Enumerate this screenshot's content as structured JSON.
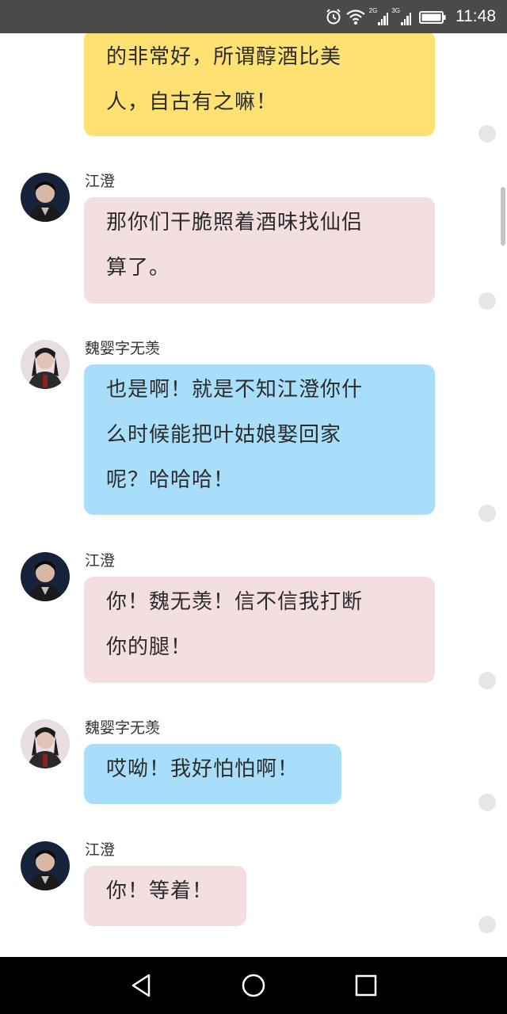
{
  "status_bar": {
    "time": "11:48",
    "network_1": "2G",
    "network_2": "3G",
    "icons": [
      "alarm-icon",
      "wifi-icon",
      "signal-icon",
      "signal-icon",
      "battery-icon"
    ]
  },
  "messages": [
    {
      "sender": "",
      "lines": [
        "的非常好，所谓醇酒比美",
        "人，自古有之嘛！"
      ],
      "color": "#fee173"
    },
    {
      "sender": "江澄",
      "lines": [
        "那你们干脆照着酒味找仙侣",
        "算了。"
      ],
      "color": "#f3dfe0"
    },
    {
      "sender": "魏婴字无羡",
      "lines": [
        "也是啊！就是不知江澄你什",
        "么时候能把叶姑娘娶回家",
        "呢？哈哈哈！"
      ],
      "color": "#a8def9"
    },
    {
      "sender": "江澄",
      "lines": [
        "你！魏无羡！信不信我打断",
        "你的腿！"
      ],
      "color": "#f3dfe0"
    },
    {
      "sender": "魏婴字无羡",
      "lines": [
        "哎呦！我好怕怕啊！"
      ],
      "color": "#a8def9"
    },
    {
      "sender": "江澄",
      "lines": [
        "你！等着！"
      ],
      "color": "#f3dfe0"
    }
  ],
  "nav_bar": {
    "icons": [
      "back-icon",
      "home-icon",
      "recents-icon"
    ]
  }
}
